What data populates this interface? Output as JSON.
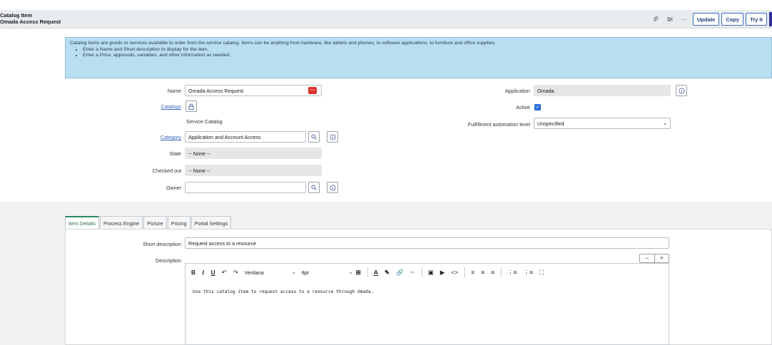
{
  "header": {
    "title_line1": "Catalog Item",
    "title_line2": "Omada Access Request",
    "icons": [
      "paperclip-icon",
      "settings-sliders-icon",
      "more-icon"
    ],
    "buttons": {
      "update": "Update",
      "copy": "Copy",
      "try_it": "Try It"
    }
  },
  "info": {
    "text": "Catalog items are goods or services available to order from the service catalog. Items can be anything from hardware, like tablets and phones, to software applications, to furniture and office supplies.",
    "bullets": [
      "Enter a Name and Short description to display for the item.",
      "Enter a Price, approvals, variables, and other information as needed."
    ]
  },
  "form": {
    "name_label": "Name",
    "name_value": "Omada Access Request",
    "catalogs_label": "Catalogs",
    "catalogs_value": "Service Catalog",
    "category_label": "Category",
    "category_value": "Application and Account Access",
    "state_label": "State",
    "state_value": "-- None --",
    "checked_out_label": "Checked out",
    "checked_out_value": "-- None --",
    "owner_label": "Owner",
    "owner_value": "",
    "application_label": "Application",
    "application_value": "Omada",
    "active_label": "Active",
    "active_checked": true,
    "fulfillment_label": "Fulfillment automation level",
    "fulfillment_value": "Unspecified"
  },
  "tabs": [
    "Item Details",
    "Process Engine",
    "Picture",
    "Pricing",
    "Portal Settings"
  ],
  "details": {
    "short_description_label": "Short description",
    "short_description_value": "Request access to a resource",
    "description_label": "Description",
    "editor_font": "Verdana",
    "editor_size": "8pt",
    "description_text": "Use this catalog item to request access to a resource through Omada.",
    "zoom_minus": "−",
    "zoom_plus": "+"
  }
}
